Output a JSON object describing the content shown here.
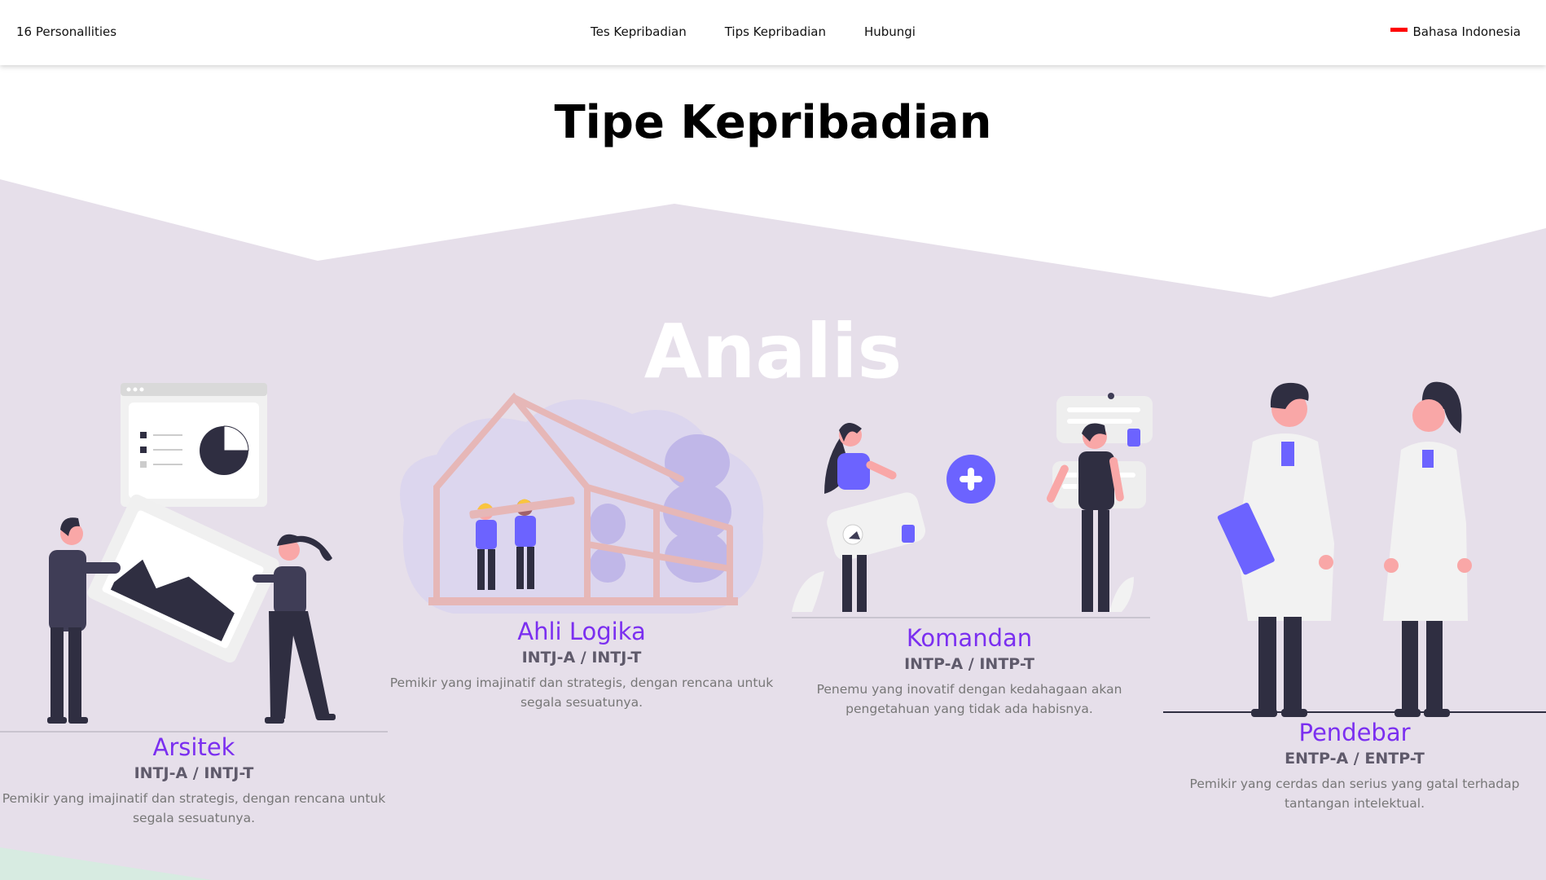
{
  "navbar": {
    "brand": "16 Personallities",
    "links": [
      "Tes Kepribadian",
      "Tips Kepribadian",
      "Hubungi"
    ],
    "language": "Bahasa Indonesia"
  },
  "page": {
    "title": "Tipe Kepribadian"
  },
  "group": {
    "title": "Analis"
  },
  "cards": [
    {
      "name": "Arsitek",
      "code": "INTJ-A / INTJ-T",
      "desc": "Pemikir yang imajinatif dan strategis, dengan rencana untuk segala sesuatunya."
    },
    {
      "name": "Ahli Logika",
      "code": "INTJ-A / INTJ-T",
      "desc": "Pemikir yang imajinatif dan strategis, dengan rencana untuk segala sesuatunya."
    },
    {
      "name": "Komandan",
      "code": "INTP-A / INTP-T",
      "desc": "Penemu yang inovatif dengan kedahagaan akan pengetahuan yang tidak ada habisnya."
    },
    {
      "name": "Pendebar",
      "code": "ENTP-A / ENTP-T",
      "desc": "Pemikir yang cerdas dan serius yang gatal terhadap tantangan intelektual."
    }
  ],
  "colors": {
    "accent": "#7b2ff0",
    "illustration_purple": "#6c63ff",
    "dark_navy": "#2f2e41",
    "section_bg": "#e6dfea",
    "skin": "#f9a7a7"
  }
}
